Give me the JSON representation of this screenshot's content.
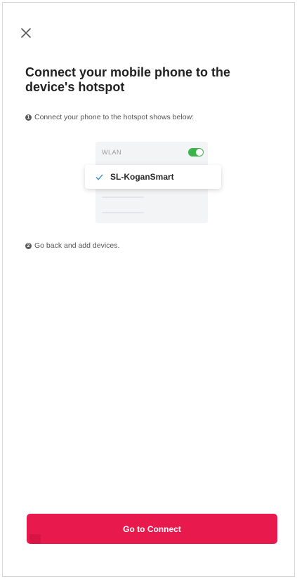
{
  "header": {
    "close_icon": "close-icon"
  },
  "main": {
    "title": "Connect your mobile phone to the device's hotspot",
    "step1": {
      "number": "1",
      "text": "Connect your phone to the hotspot shows below:"
    },
    "illustration": {
      "wlan_label": "WLAN",
      "wlan_toggle_on": true,
      "network_name": "SL-KoganSmart",
      "selected_icon": "checkmark-icon"
    },
    "step2": {
      "number": "2",
      "text": "Go back and add devices."
    }
  },
  "footer": {
    "connect_label": "Go to Connect"
  },
  "colors": {
    "accent": "#e8194c",
    "toggle_on": "#3bb54a",
    "check": "#3a86c8",
    "title_text": "#222222"
  }
}
